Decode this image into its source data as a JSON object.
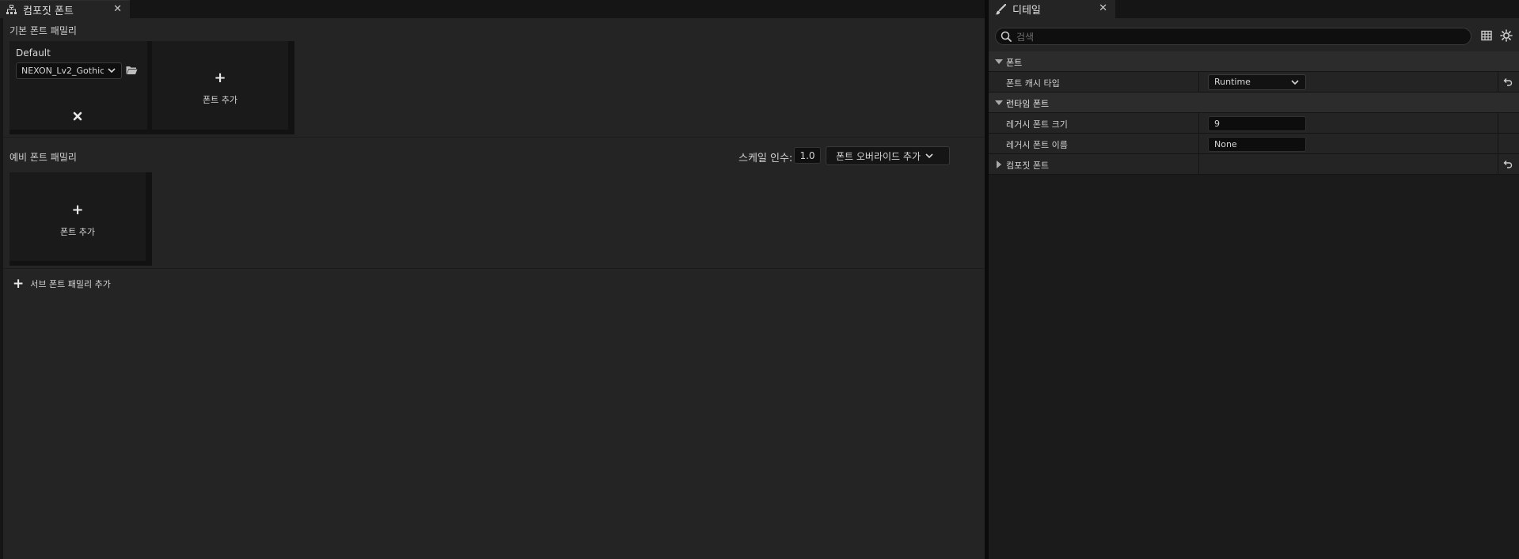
{
  "left_tab": {
    "title": "컴포짓 폰트",
    "icon": "hierarchy-icon",
    "close": "✕"
  },
  "default_family": {
    "section_label": "기본 폰트 패밀리",
    "entry_name": "Default",
    "font_value": "NEXON_Lv2_Gothic",
    "add_font_label": "폰트 추가"
  },
  "fallback_family": {
    "section_label": "예비 폰트 패밀리",
    "scale_label": "스케일 인수:",
    "scale_value": "1.0",
    "override_label": "폰트 오버라이드 추가",
    "add_font_label": "폰트 추가"
  },
  "add_sub_family_label": "서브 폰트 패밀리 추가",
  "right_tab": {
    "title": "디테일",
    "icon": "brush-icon",
    "close": "✕"
  },
  "search": {
    "placeholder": "검색"
  },
  "details": {
    "cat_font": "폰트",
    "font_cache_type_label": "폰트 캐시 타입",
    "font_cache_type_value": "Runtime",
    "cat_runtime_font": "런타임 폰트",
    "legacy_font_size_label": "레거시 폰트 크기",
    "legacy_font_size_value": "9",
    "legacy_font_name_label": "레거시 폰트 이름",
    "legacy_font_name_value": "None",
    "composite_font_label": "컴포짓 폰트"
  },
  "colors": {
    "panel_bg": "#242424",
    "window_bg": "#151515",
    "text": "#d0d0d0"
  }
}
